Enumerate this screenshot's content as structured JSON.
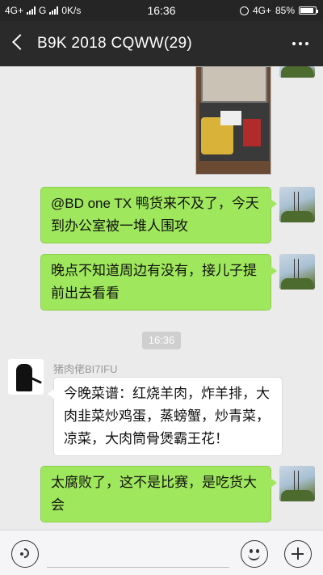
{
  "status_bar": {
    "left": [
      "4G+",
      "G",
      "0K/s"
    ],
    "time": "16:36",
    "network": "4G+",
    "battery": "85%"
  },
  "header": {
    "title": "B9K 2018 CQWW(29)"
  },
  "messages": [
    {
      "type": "image",
      "from": "me"
    },
    {
      "type": "text",
      "from": "me",
      "text": "@BD one TX  鸭货来不及了，今天到办公室被一堆人围攻"
    },
    {
      "type": "text",
      "from": "me",
      "text": "晚点不知道周边有没有，接儿子提前出去看看"
    },
    {
      "type": "timestamp",
      "text": "16:36"
    },
    {
      "type": "text",
      "from": "other",
      "sender": "猪肉佬BI7IFU",
      "text": "今晚菜谱：红烧羊肉，炸羊排，大肉韭菜炒鸡蛋，蒸螃蟹，炒青菜，凉菜，大肉筒骨煲霸王花！"
    },
    {
      "type": "text",
      "from": "me",
      "text": "太腐败了，这不是比赛，是吃货大会"
    }
  ]
}
